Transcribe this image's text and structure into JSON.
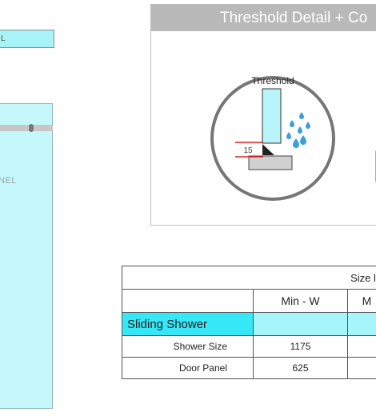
{
  "left_area": {
    "top_label": "L",
    "panel_label": "NEL"
  },
  "detail": {
    "title": "Threshold Detail + Co",
    "circle_label": "Threshold",
    "dimension": "15"
  },
  "size_table": {
    "title": "Size lin",
    "col_headers": [
      "Min - W",
      "M"
    ],
    "section": "Sliding Shower",
    "rows": [
      {
        "label": "Shower Size",
        "min_w": "1175",
        "m": ""
      },
      {
        "label": "Door Panel",
        "min_w": "625",
        "m": ""
      }
    ]
  },
  "colors": {
    "cyan_strong": "#35e7f7",
    "cyan_light": "#a5f5fb",
    "header_gray": "#b9b9b9",
    "water_blue": "#3aa0dc",
    "dimension_red": "#e02020"
  }
}
